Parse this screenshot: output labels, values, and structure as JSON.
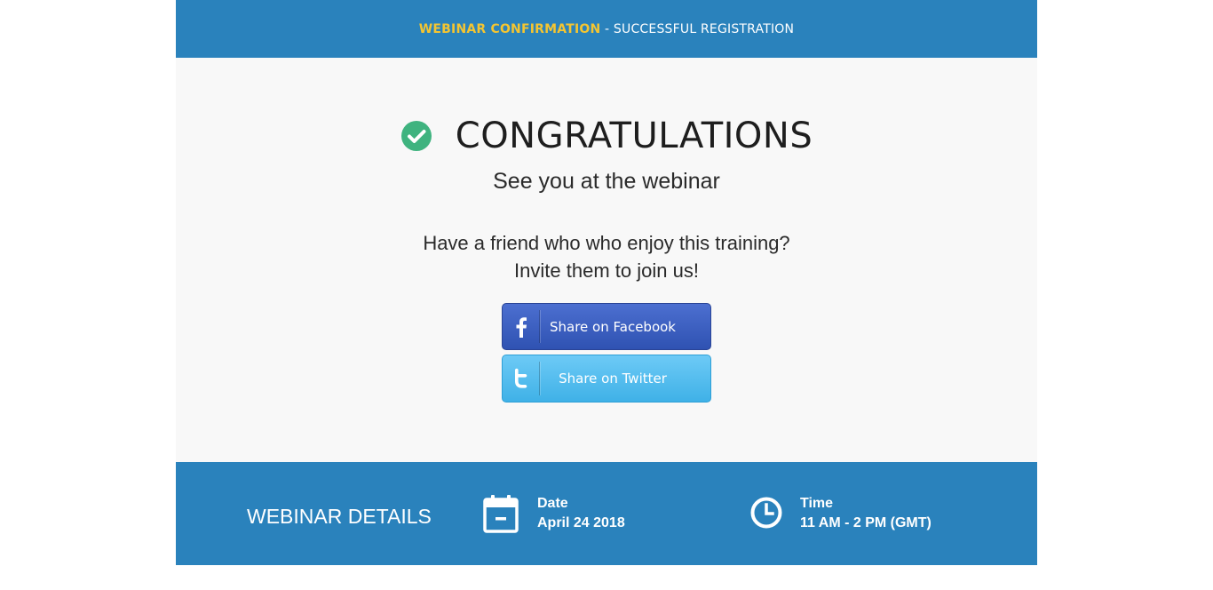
{
  "header": {
    "highlight": "WEBINAR CONFIRMATION",
    "rest": " - SUCCESSFUL REGISTRATION",
    "colors": {
      "background": "#2a82bc",
      "highlight": "#f4c531"
    }
  },
  "hero": {
    "icon": "check-circle-icon",
    "icon_color": "#3fb37f",
    "title": "CONGRATULATIONS",
    "subtitle": "See you at the webinar"
  },
  "invite": {
    "line1": "Have a friend who who enjoy this training?",
    "line2": "Invite them to join us!"
  },
  "share": {
    "facebook": {
      "icon": "facebook-icon",
      "label": "Share on Facebook",
      "color": "#3a5cc0"
    },
    "twitter": {
      "icon": "twitter-icon",
      "label": "Share on Twitter",
      "color": "#52bdee"
    }
  },
  "details": {
    "title": "WEBINAR DETAILS",
    "date": {
      "icon": "calendar-icon",
      "label": "Date",
      "value": "April 24 2018"
    },
    "time": {
      "icon": "clock-icon",
      "label": "Time",
      "value": "11 AM - 2 PM (GMT)"
    }
  }
}
